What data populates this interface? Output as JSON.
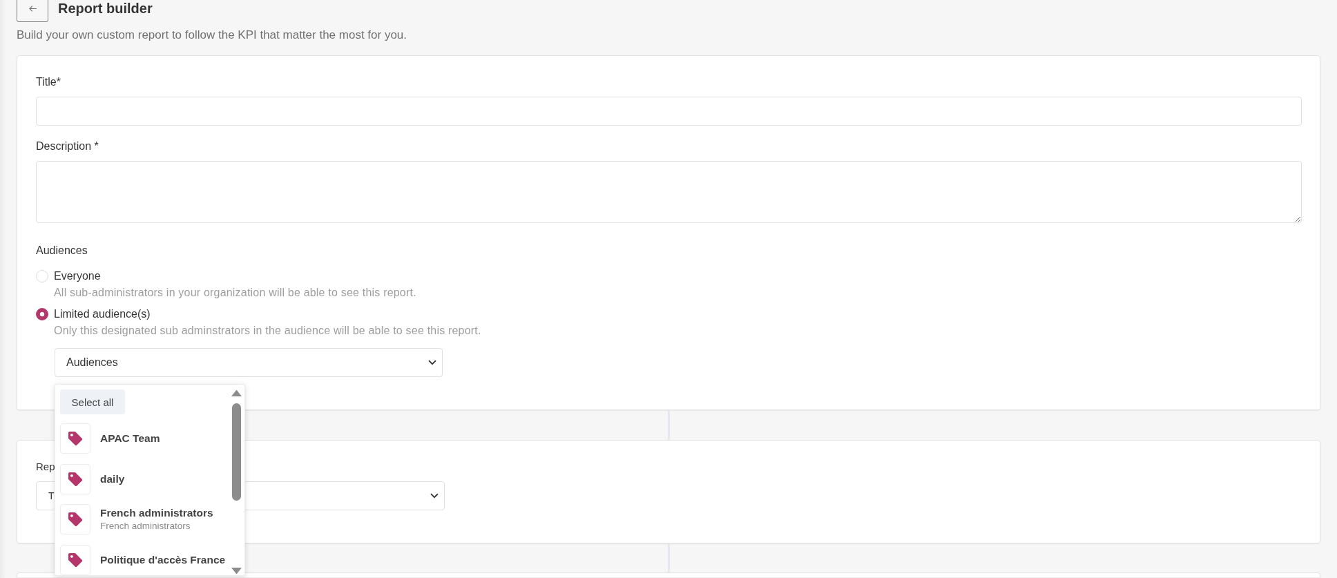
{
  "header": {
    "title": "Report builder",
    "subtitle": "Build your own custom report to follow the KPI that matter the most for you."
  },
  "form": {
    "fields": [
      {
        "kind": "text",
        "label": "Title*"
      },
      {
        "kind": "textarea",
        "label": "Description *"
      }
    ],
    "audiences": {
      "label": "Audiences",
      "options": [
        {
          "label": "Everyone",
          "description": "All sub-administrators in your organization will be able to see this report.",
          "selected": false
        },
        {
          "label": "Limited audience(s)",
          "description": "Only this designated sub adminstrators in the audience will be able to see this report.",
          "selected": true
        }
      ],
      "select": {
        "label": "Audiences",
        "menu": {
          "select_all": "Select all",
          "items": [
            {
              "name": "APAC Team",
              "selected": false
            },
            {
              "name": "daily",
              "selected": false
            },
            {
              "name": "French administrators",
              "description": "French administrators",
              "selected": false
            },
            {
              "name": "Politique d'accès France",
              "selected": false
            }
          ]
        }
      }
    }
  },
  "report_section": {
    "label": "Rep",
    "value": "T"
  }
}
